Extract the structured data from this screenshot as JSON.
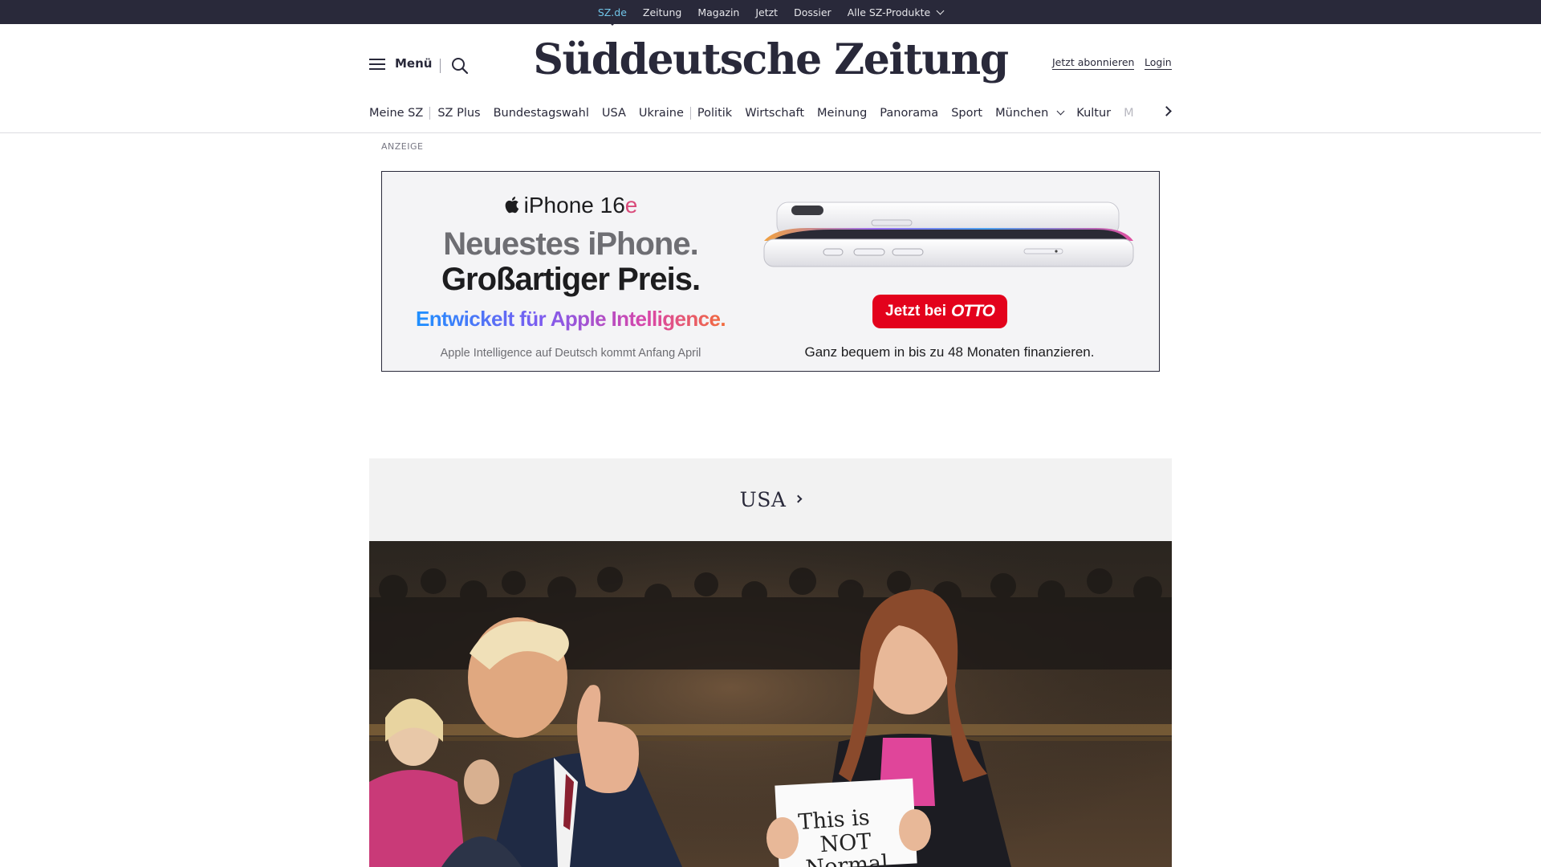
{
  "topbar": {
    "items": [
      "SZ.de",
      "Zeitung",
      "Magazin",
      "Jetzt",
      "Dossier",
      "Alle SZ-Produkte"
    ]
  },
  "header": {
    "menu_label": "Menü",
    "logo": "Süddeutsche Zeitung",
    "subscribe": "Jetzt abonnieren",
    "login": "Login"
  },
  "nav": {
    "items": [
      "Meine SZ",
      "SZ Plus",
      "Bundestagswahl",
      "USA",
      "Ukraine",
      "Politik",
      "Wirtschaft",
      "Meinung",
      "Panorama",
      "Sport",
      "München",
      "Kultur",
      "M"
    ]
  },
  "ad": {
    "label": "ANZEIGE",
    "brand": "iPhone 16",
    "brand_suffix": "e",
    "headline_1": "Neuestes iPhone.",
    "headline_2": "Großartiger Preis.",
    "ai_line": "Entwickelt für Apple Intelligence.",
    "note": "Apple Intelligence auf Deutsch kommt Anfang April",
    "cta": "Jetzt bei",
    "cta_brand": "OTTO",
    "financing": "Ganz bequem in bis zu 48 Monaten finanzieren."
  },
  "section": {
    "title": "USA"
  },
  "photo": {
    "sign_line_1": "This is",
    "sign_line_2": "NOT",
    "sign_line_3": "Normal"
  }
}
